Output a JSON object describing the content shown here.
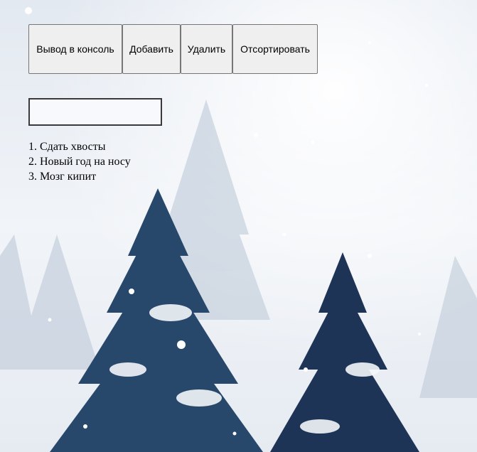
{
  "toolbar": {
    "console_label": "Вывод в консоль",
    "add_label": "Добавить",
    "delete_label": "Удалить",
    "sort_label": "Отсортировать"
  },
  "task_input": {
    "value": "",
    "placeholder": ""
  },
  "tasks": [
    {
      "number": "1.",
      "text": "Сдать хвосты"
    },
    {
      "number": "2.",
      "text": "Новый год на носу"
    },
    {
      "number": "3.",
      "text": "Мозг кипит"
    }
  ],
  "colors": {
    "tree_dark": "#1f3b5c",
    "tree_mid": "#3d5f85",
    "sky": "#eef2f7"
  }
}
